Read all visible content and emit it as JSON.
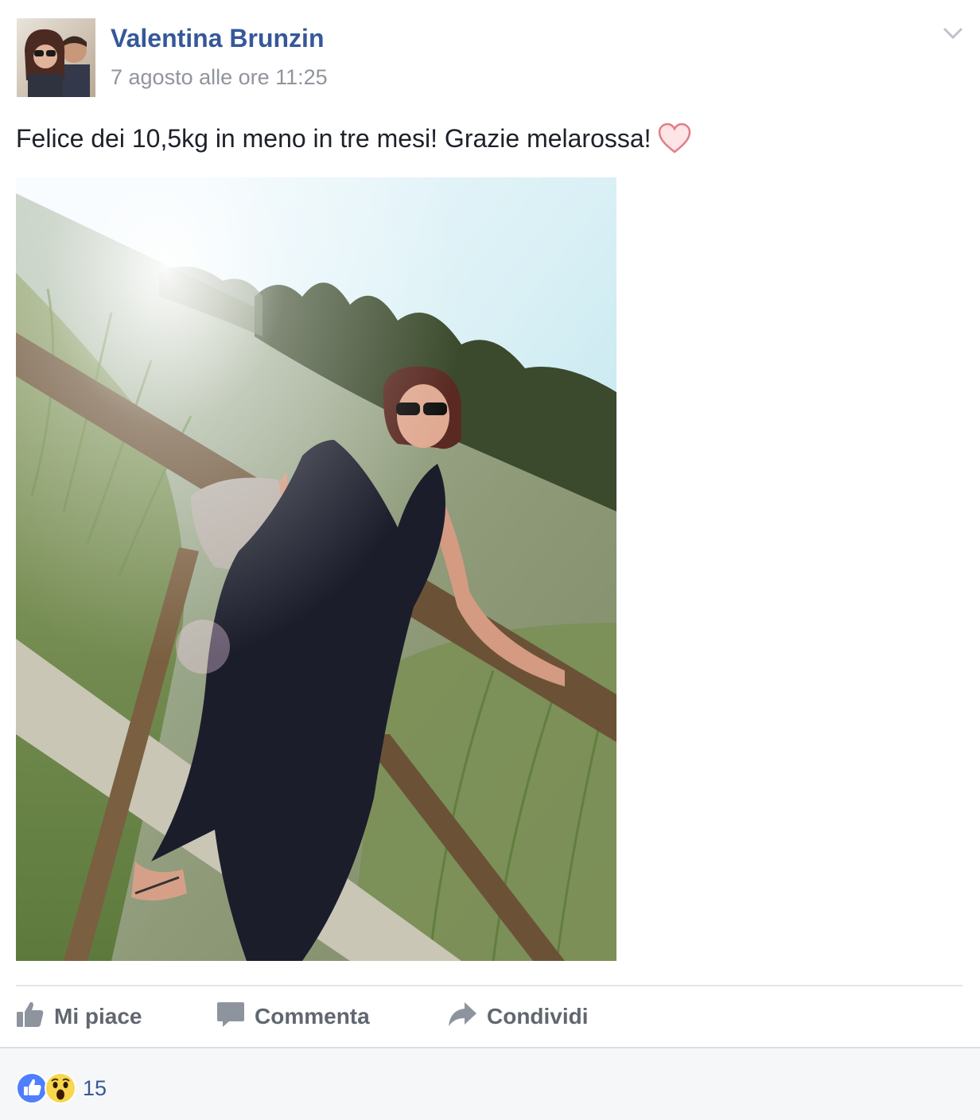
{
  "post": {
    "author": "Valentina Brunzin",
    "timestamp": "7 agosto alle ore 11:25",
    "message": "Felice dei 10,5kg in meno in tre mesi! Grazie melarossa!",
    "message_emoji": "heart-icon"
  },
  "actions": {
    "like_label": "Mi piace",
    "comment_label": "Commenta",
    "share_label": "Condividi"
  },
  "reactions": {
    "types": [
      "like",
      "wow"
    ],
    "count": "15"
  },
  "colors": {
    "author": "#365899",
    "timestamp": "#90949c",
    "text": "#1d2129",
    "action": "#616770",
    "like_blue": "#4f7fff",
    "wow_yellow": "#f8d64e",
    "heart": "#f4a3ab"
  }
}
